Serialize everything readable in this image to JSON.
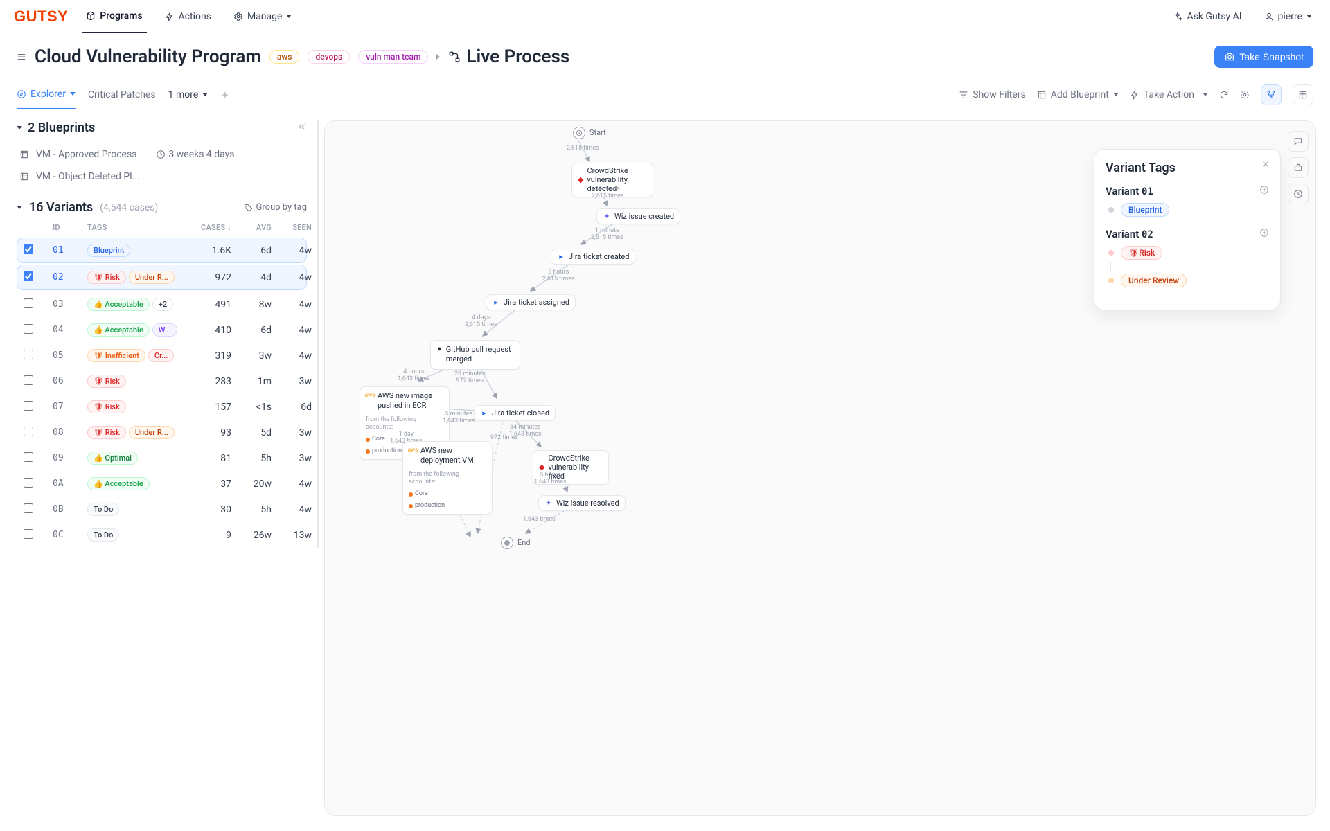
{
  "nav": {
    "programs": "Programs",
    "actions": "Actions",
    "manage": "Manage",
    "ask_ai": "Ask Gutsy AI",
    "user": "pierre"
  },
  "header": {
    "title": "Cloud Vulnerability Program",
    "tags": [
      "aws",
      "devops",
      "vuln man team"
    ],
    "live_process": "Live Process",
    "snapshot_btn": "Take Snapshot"
  },
  "tabs": {
    "explorer": "Explorer",
    "critical": "Critical Patches",
    "more": "1 more",
    "show_filters": "Show Filters",
    "add_blueprint": "Add Blueprint",
    "take_action": "Take Action"
  },
  "blueprints": {
    "heading": "2 Blueprints",
    "items": [
      {
        "name": "VM - Approved Process",
        "duration": "3 weeks 4 days"
      },
      {
        "name": "VM - Object Deleted Pl...",
        "duration": ""
      }
    ]
  },
  "variants": {
    "heading": "16 Variants",
    "cases_label": "(4,544 cases)",
    "group_by": "Group by tag",
    "columns": {
      "id": "ID",
      "tags": "TAGS",
      "cases": "CASES",
      "avg": "AVG",
      "seen": "SEEN"
    },
    "rows": [
      {
        "selected": true,
        "id": "01",
        "tags": [
          {
            "kind": "blueprint",
            "text": "Blueprint"
          }
        ],
        "cases": "1.6K",
        "avg": "6d",
        "seen": "4w"
      },
      {
        "selected": true,
        "id": "02",
        "tags": [
          {
            "kind": "risk",
            "text": "Risk"
          },
          {
            "kind": "under",
            "text": "Under R..."
          }
        ],
        "cases": "972",
        "avg": "4d",
        "seen": "4w"
      },
      {
        "selected": false,
        "id": "03",
        "tags": [
          {
            "kind": "accept",
            "text": "Acceptable"
          },
          {
            "kind": "plus2",
            "text": "+2"
          }
        ],
        "cases": "491",
        "avg": "8w",
        "seen": "4w"
      },
      {
        "selected": false,
        "id": "04",
        "tags": [
          {
            "kind": "accept",
            "text": "Acceptable"
          },
          {
            "kind": "w",
            "text": "W..."
          }
        ],
        "cases": "410",
        "avg": "6d",
        "seen": "4w"
      },
      {
        "selected": false,
        "id": "05",
        "tags": [
          {
            "kind": "ineff",
            "text": "Inefficient"
          },
          {
            "kind": "cr",
            "text": "Cr..."
          }
        ],
        "cases": "319",
        "avg": "3w",
        "seen": "4w"
      },
      {
        "selected": false,
        "id": "06",
        "tags": [
          {
            "kind": "risk",
            "text": "Risk"
          }
        ],
        "cases": "283",
        "avg": "1m",
        "seen": "3w"
      },
      {
        "selected": false,
        "id": "07",
        "tags": [
          {
            "kind": "risk",
            "text": "Risk"
          }
        ],
        "cases": "157",
        "avg": "<1s",
        "seen": "6d"
      },
      {
        "selected": false,
        "id": "08",
        "tags": [
          {
            "kind": "risk",
            "text": "Risk"
          },
          {
            "kind": "under",
            "text": "Under R..."
          }
        ],
        "cases": "93",
        "avg": "5d",
        "seen": "3w"
      },
      {
        "selected": false,
        "id": "09",
        "tags": [
          {
            "kind": "optimal",
            "text": "Optimal"
          }
        ],
        "cases": "81",
        "avg": "5h",
        "seen": "3w"
      },
      {
        "selected": false,
        "id": "0A",
        "tags": [
          {
            "kind": "accept",
            "text": "Acceptable"
          }
        ],
        "cases": "37",
        "avg": "20w",
        "seen": "4w"
      },
      {
        "selected": false,
        "id": "0B",
        "tags": [
          {
            "kind": "todo",
            "text": "To Do"
          }
        ],
        "cases": "30",
        "avg": "5h",
        "seen": "4w"
      },
      {
        "selected": false,
        "id": "0C",
        "tags": [
          {
            "kind": "todo",
            "text": "To Do"
          }
        ],
        "cases": "9",
        "avg": "26w",
        "seen": "13w"
      }
    ]
  },
  "flow": {
    "start": "Start",
    "end": "End",
    "nodes": [
      {
        "id": "n1",
        "text": "CrowdStrike vulnerability detected",
        "icon": "crowdstrike"
      },
      {
        "id": "n2",
        "text": "Wiz issue created",
        "icon": "wiz"
      },
      {
        "id": "n3",
        "text": "Jira ticket created",
        "icon": "jira"
      },
      {
        "id": "n4",
        "text": "Jira ticket assigned",
        "icon": "jira"
      },
      {
        "id": "n5",
        "text": "GitHub pull request merged",
        "icon": "github"
      },
      {
        "id": "n6",
        "text": "AWS new image pushed in ECR",
        "sub": "from the following accounts:",
        "accts": [
          "Core",
          "production"
        ],
        "icon": "aws"
      },
      {
        "id": "n7",
        "text": "AWS new deployment VM",
        "sub": "from the following accounts:",
        "accts": [
          "Core",
          "production"
        ],
        "icon": "aws"
      },
      {
        "id": "n8",
        "text": "Jira ticket closed",
        "icon": "jira"
      },
      {
        "id": "n9",
        "text": "CrowdStrike vulnerability fixed",
        "icon": "crowdstrike"
      },
      {
        "id": "n10",
        "text": "Wiz issue resolved",
        "icon": "wiz"
      }
    ],
    "edges": [
      {
        "text": "2,615 times"
      },
      {
        "text": "11 hours",
        "text2": "2,615 times"
      },
      {
        "text": "1 minute",
        "text2": "2,615 times"
      },
      {
        "text": "8 hours",
        "text2": "2,615 times"
      },
      {
        "text": "4 days",
        "text2": "2,615 times",
        "hi": true
      },
      {
        "text": "4 hours",
        "text2": "1,643 times"
      },
      {
        "text": "28 minutes",
        "text2": "972 times"
      },
      {
        "text": "1 day",
        "text2": "1,643 times"
      },
      {
        "text": "5 minutes",
        "text2": "1,643 times"
      },
      {
        "text": "972 times"
      },
      {
        "text": "34 minutes",
        "text2": "1,643 times"
      },
      {
        "text": "5 hours",
        "text2": "1,643 times"
      },
      {
        "text": "1,643 times"
      }
    ]
  },
  "popup": {
    "title": "Variant Tags",
    "v1": "Variant",
    "v1id": "01",
    "v1tags": [
      {
        "kind": "blueprint",
        "text": "Blueprint"
      }
    ],
    "v2": "Variant",
    "v2id": "02",
    "v2tags": [
      {
        "kind": "risk",
        "text": "Risk"
      },
      {
        "kind": "under",
        "text": "Under Review"
      }
    ]
  }
}
